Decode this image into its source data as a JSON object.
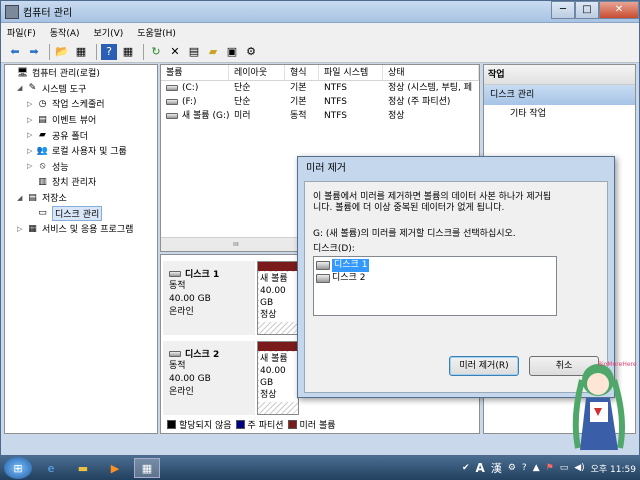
{
  "window": {
    "title": "컴퓨터 관리"
  },
  "menu": [
    "파일(F)",
    "동작(A)",
    "보기(V)",
    "도움말(H)"
  ],
  "tree": [
    {
      "label": "컴퓨터 관리(로컬)",
      "icon": "computer-icon",
      "level": 0,
      "exp": ""
    },
    {
      "label": "시스템 도구",
      "icon": "tools-icon",
      "level": 1,
      "exp": "◢"
    },
    {
      "label": "작업 스케줄러",
      "icon": "clock-icon",
      "level": 2,
      "exp": "▷"
    },
    {
      "label": "이벤트 뷰어",
      "icon": "event-viewer-icon",
      "level": 2,
      "exp": "▷"
    },
    {
      "label": "공유 폴더",
      "icon": "shared-folder-icon",
      "level": 2,
      "exp": "▷"
    },
    {
      "label": "로컬 사용자 및 그룹",
      "icon": "users-icon",
      "level": 2,
      "exp": "▷"
    },
    {
      "label": "성능",
      "icon": "performance-icon",
      "level": 2,
      "exp": "▷"
    },
    {
      "label": "장치 관리자",
      "icon": "device-manager-icon",
      "level": 2,
      "exp": ""
    },
    {
      "label": "저장소",
      "icon": "storage-icon",
      "level": 1,
      "exp": "◢"
    },
    {
      "label": "디스크 관리",
      "icon": "disk-management-icon",
      "level": 2,
      "exp": "",
      "selected": true
    },
    {
      "label": "서비스 및 응용 프로그램",
      "icon": "services-icon",
      "level": 1,
      "exp": "▷"
    }
  ],
  "volume_headers": [
    "볼륨",
    "레이아웃",
    "형식",
    "파일 시스템",
    "상태"
  ],
  "volumes": [
    [
      "(C:)",
      "단순",
      "기본",
      "NTFS",
      "정상 (시스템, 부팅, 페"
    ],
    [
      "(F:)",
      "단순",
      "기본",
      "NTFS",
      "정상 (주 파티션)"
    ],
    [
      "새 볼륨 (G:)",
      "미러",
      "동적",
      "NTFS",
      "정상"
    ]
  ],
  "disks": [
    {
      "name": "디스크 1",
      "type": "동적",
      "size": "40.00 GB",
      "status": "온라인",
      "vol_name": "새 볼륨",
      "vol_size": "40.00 GB",
      "vol_status": "정상"
    },
    {
      "name": "디스크 2",
      "type": "동적",
      "size": "40.00 GB",
      "status": "온라인",
      "vol_name": "새 볼륨",
      "vol_size": "40.00 GB",
      "vol_status": "정상"
    }
  ],
  "legend": [
    {
      "label": "할당되지 않음",
      "color": "#000000"
    },
    {
      "label": "주 파티션",
      "color": "#000080"
    },
    {
      "label": "미러 볼륨",
      "color": "#7a1a1a"
    }
  ],
  "actions": {
    "header": "작업",
    "section": "디스크 관리",
    "item": "기타 작업"
  },
  "dialog": {
    "title": "미러 제거",
    "message": "이 볼륨에서 미러를 제거하면 볼륨의 데이터 사본 하나가 제거됩니다. 볼륨에 더 이상 중복된 데이터가 없게 됩니다.",
    "prompt": "G: (새 볼륨)의 미러를 제거할 디스크를 선택하십시오.",
    "list_label": "디스크(D):",
    "items": [
      "디스크 1",
      "디스크 2"
    ],
    "ok": "미러 제거(R)",
    "cancel": "취소"
  },
  "tray": {
    "lang": "A",
    "hanja": "漢",
    "time": "오후 11:59"
  }
}
